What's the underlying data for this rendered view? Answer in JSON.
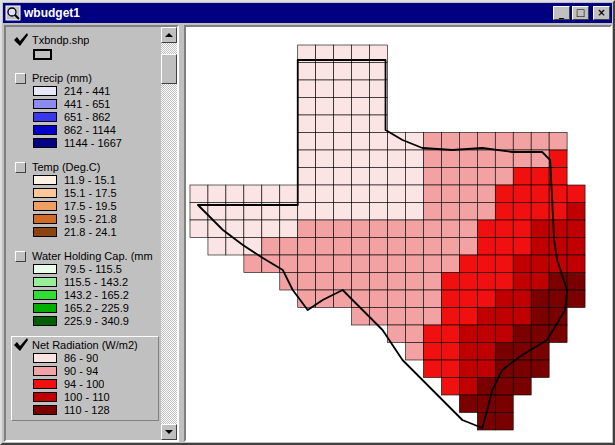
{
  "window": {
    "title": "wbudget1",
    "controls": [
      "_",
      "□",
      "×"
    ]
  },
  "legend": {
    "layers": [
      {
        "name": "Txbndp.shp",
        "checked": true,
        "active": false,
        "kind": "outline",
        "classes": []
      },
      {
        "name": "Precip (mm)",
        "checked": false,
        "active": false,
        "kind": "graduated",
        "classes": [
          {
            "label": "214 - 441",
            "color": "#e8e8fa"
          },
          {
            "label": "441 - 651",
            "color": "#8c8cf0"
          },
          {
            "label": "651 - 862",
            "color": "#3838f0"
          },
          {
            "label": "862 - 1144",
            "color": "#0000c8"
          },
          {
            "label": "1144 - 1667",
            "color": "#000080"
          }
        ]
      },
      {
        "name": "Temp (Deg.C)",
        "checked": false,
        "active": false,
        "kind": "graduated",
        "classes": [
          {
            "label": "11.9 - 15.1",
            "color": "#fff2e4"
          },
          {
            "label": "15.1 - 17.5",
            "color": "#fcc898"
          },
          {
            "label": "17.5 - 19.5",
            "color": "#eea060"
          },
          {
            "label": "19.5 - 21.8",
            "color": "#d06a24"
          },
          {
            "label": "21.8 - 24.1",
            "color": "#8b4513"
          }
        ]
      },
      {
        "name": "Water Holding Cap. (mm",
        "checked": false,
        "active": false,
        "kind": "graduated",
        "classes": [
          {
            "label": "79.5 - 115.5",
            "color": "#eaffea"
          },
          {
            "label": "115.5 - 143.2",
            "color": "#96f096"
          },
          {
            "label": "143.2 - 165.2",
            "color": "#30e030"
          },
          {
            "label": "165.2 - 225.9",
            "color": "#00b000"
          },
          {
            "label": "225.9 - 340.9",
            "color": "#006000"
          }
        ]
      },
      {
        "name": "Net Radiation (W/m2)",
        "checked": true,
        "active": true,
        "kind": "graduated",
        "classes": [
          {
            "label": "86 - 90",
            "color": "#fbe4e4"
          },
          {
            "label": "90 - 94",
            "color": "#f2a2a2"
          },
          {
            "label": "94 - 100",
            "color": "#f01010"
          },
          {
            "label": "100 - 110",
            "color": "#c00000"
          },
          {
            "label": "110 - 128",
            "color": "#7a0000"
          }
        ]
      }
    ]
  },
  "scrollbar": {
    "level": 0.03
  },
  "map": {
    "grid": [
      [
        0,
        0,
        0,
        0,
        0,
        0,
        1,
        1,
        1,
        1,
        1,
        0,
        0,
        0,
        0,
        0,
        0,
        0,
        0,
        0,
        0,
        0,
        0
      ],
      [
        0,
        0,
        0,
        0,
        0,
        0,
        1,
        1,
        1,
        1,
        1,
        0,
        0,
        0,
        0,
        0,
        0,
        0,
        0,
        0,
        0,
        0,
        0
      ],
      [
        0,
        0,
        0,
        0,
        0,
        0,
        1,
        1,
        1,
        1,
        1,
        0,
        0,
        0,
        0,
        0,
        0,
        0,
        0,
        0,
        0,
        0,
        0
      ],
      [
        0,
        0,
        0,
        0,
        0,
        0,
        1,
        1,
        1,
        1,
        1,
        0,
        0,
        0,
        0,
        0,
        0,
        0,
        0,
        0,
        0,
        0,
        0
      ],
      [
        0,
        0,
        0,
        0,
        0,
        0,
        1,
        1,
        1,
        1,
        1,
        0,
        0,
        0,
        0,
        0,
        0,
        0,
        0,
        0,
        0,
        0,
        0
      ],
      [
        0,
        0,
        0,
        0,
        0,
        0,
        1,
        1,
        1,
        1,
        1,
        1,
        1,
        2,
        2,
        2,
        2,
        2,
        2,
        2,
        2,
        0,
        0
      ],
      [
        0,
        0,
        0,
        0,
        0,
        0,
        1,
        1,
        1,
        1,
        1,
        1,
        1,
        2,
        2,
        2,
        2,
        2,
        2,
        2,
        3,
        0,
        0
      ],
      [
        0,
        0,
        0,
        0,
        0,
        0,
        1,
        1,
        1,
        1,
        1,
        1,
        1,
        2,
        2,
        2,
        2,
        2,
        3,
        3,
        3,
        0,
        0
      ],
      [
        1,
        1,
        1,
        1,
        1,
        1,
        1,
        1,
        1,
        1,
        1,
        1,
        1,
        2,
        2,
        2,
        2,
        3,
        3,
        3,
        3,
        3,
        0
      ],
      [
        1,
        1,
        1,
        1,
        1,
        1,
        1,
        1,
        1,
        1,
        1,
        1,
        1,
        2,
        2,
        2,
        2,
        3,
        3,
        3,
        3,
        4,
        0
      ],
      [
        1,
        1,
        1,
        1,
        1,
        1,
        2,
        2,
        2,
        2,
        2,
        2,
        2,
        2,
        2,
        2,
        3,
        3,
        3,
        4,
        4,
        4,
        0
      ],
      [
        0,
        1,
        1,
        1,
        2,
        2,
        2,
        2,
        2,
        2,
        2,
        2,
        2,
        2,
        2,
        2,
        3,
        3,
        3,
        4,
        4,
        4,
        0
      ],
      [
        0,
        0,
        0,
        2,
        2,
        2,
        2,
        2,
        2,
        2,
        2,
        2,
        2,
        2,
        2,
        3,
        3,
        3,
        4,
        4,
        4,
        4,
        0
      ],
      [
        0,
        0,
        0,
        0,
        0,
        2,
        2,
        2,
        2,
        2,
        2,
        2,
        2,
        2,
        3,
        3,
        3,
        3,
        4,
        4,
        5,
        5,
        0
      ],
      [
        0,
        0,
        0,
        0,
        0,
        0,
        2,
        2,
        2,
        2,
        2,
        2,
        2,
        2,
        3,
        3,
        3,
        4,
        4,
        5,
        5,
        5,
        0
      ],
      [
        0,
        0,
        0,
        0,
        0,
        0,
        0,
        0,
        0,
        2,
        2,
        2,
        2,
        2,
        3,
        3,
        4,
        4,
        4,
        5,
        5,
        0,
        0
      ],
      [
        0,
        0,
        0,
        0,
        0,
        0,
        0,
        0,
        0,
        0,
        0,
        2,
        2,
        3,
        3,
        4,
        4,
        4,
        5,
        5,
        5,
        0,
        0
      ],
      [
        0,
        0,
        0,
        0,
        0,
        0,
        0,
        0,
        0,
        0,
        0,
        0,
        2,
        3,
        3,
        4,
        4,
        5,
        5,
        5,
        0,
        0,
        0
      ],
      [
        0,
        0,
        0,
        0,
        0,
        0,
        0,
        0,
        0,
        0,
        0,
        0,
        0,
        3,
        3,
        4,
        4,
        5,
        5,
        5,
        0,
        0,
        0
      ],
      [
        0,
        0,
        0,
        0,
        0,
        0,
        0,
        0,
        0,
        0,
        0,
        0,
        0,
        0,
        3,
        4,
        5,
        5,
        5,
        0,
        0,
        0,
        0
      ],
      [
        0,
        0,
        0,
        0,
        0,
        0,
        0,
        0,
        0,
        0,
        0,
        0,
        0,
        0,
        0,
        5,
        5,
        5,
        0,
        0,
        0,
        0,
        0
      ],
      [
        0,
        0,
        0,
        0,
        0,
        0,
        0,
        0,
        0,
        0,
        0,
        0,
        0,
        0,
        0,
        0,
        5,
        5,
        0,
        0,
        0,
        0,
        0
      ]
    ]
  }
}
